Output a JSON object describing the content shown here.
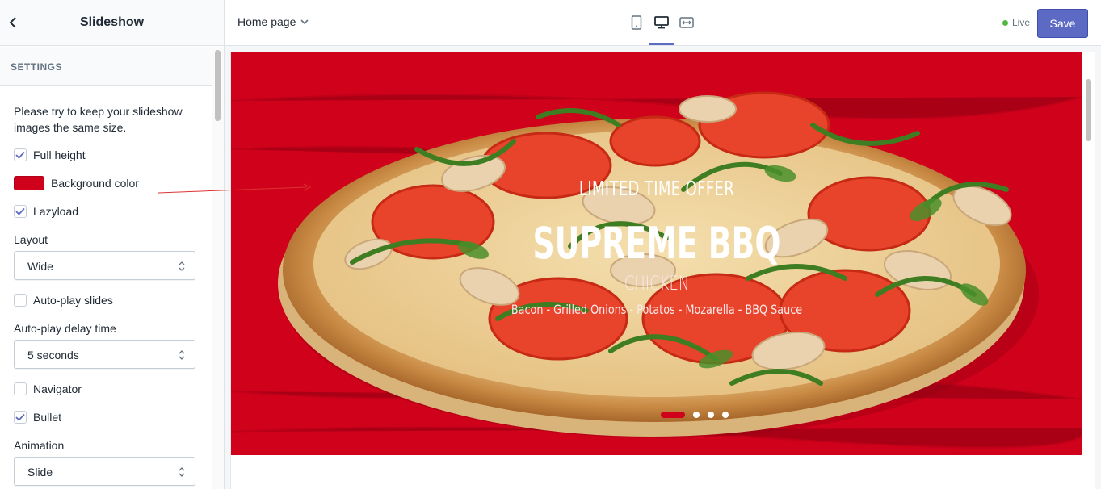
{
  "sidebar": {
    "title": "Slideshow",
    "section_label": "SETTINGS",
    "note": "Please try to keep your slideshow images the same size.",
    "full_height": {
      "label": "Full height",
      "checked": true
    },
    "background_color": {
      "label": "Background color",
      "color": "#d0011b"
    },
    "lazyload": {
      "label": "Lazyload",
      "checked": true
    },
    "layout": {
      "label": "Layout",
      "value": "Wide"
    },
    "autoplay": {
      "label": "Auto-play slides",
      "checked": false
    },
    "autoplay_delay": {
      "label": "Auto-play delay time",
      "value": "5 seconds"
    },
    "navigator": {
      "label": "Navigator",
      "checked": false
    },
    "bullet": {
      "label": "Bullet",
      "checked": true
    },
    "animation": {
      "label": "Animation",
      "value": "Slide"
    }
  },
  "topbar": {
    "page": "Home page",
    "status": "Live",
    "save_label": "Save",
    "accent": "#5c6ac4",
    "active_device": "desktop"
  },
  "slide": {
    "offer": "LIMITED TIME OFFER",
    "title": "SUPREME BBQ",
    "subtitle": "CHICKEN",
    "description": "Bacon - Grilled Onions - Potatos - Mozarella - BBQ Sauce",
    "background": "#d0011b",
    "bullets_count": 4,
    "active_bullet": 1
  }
}
